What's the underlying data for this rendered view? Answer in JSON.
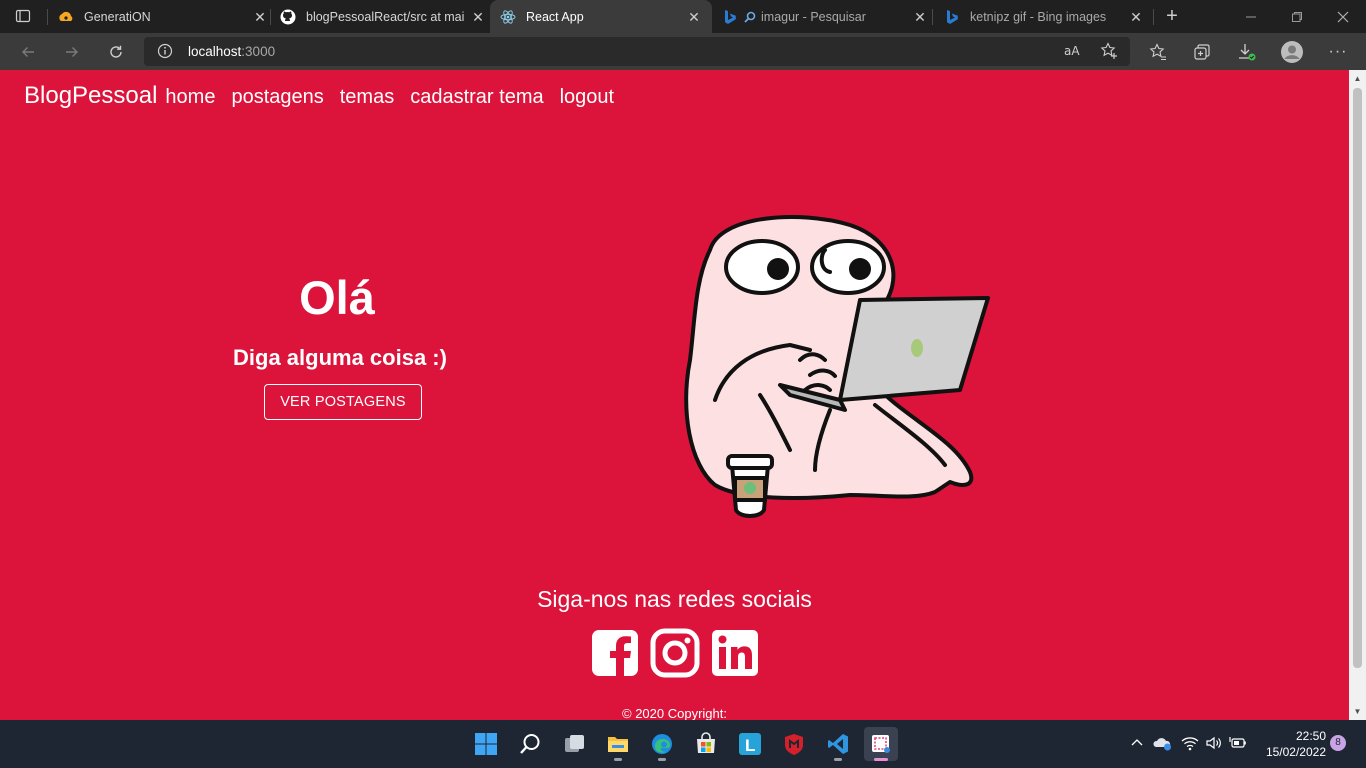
{
  "browser": {
    "tabs": [
      {
        "title": "GeneratiON",
        "icon": "generation-icon"
      },
      {
        "title": "blogPessoalReact/src at main",
        "icon": "github-icon"
      },
      {
        "title": "React App",
        "icon": "react-icon"
      },
      {
        "title": "imagur - Pesquisar",
        "icon": "bing-icon"
      },
      {
        "title": "ketnipz gif - Bing images",
        "icon": "bing-icon"
      }
    ],
    "url_host": "localhost",
    "url_port": ":3000"
  },
  "page": {
    "nav": {
      "brand": "BlogPessoal",
      "links": [
        "home",
        "postagens",
        "temas",
        "cadastrar tema",
        "logout"
      ]
    },
    "hero": {
      "title": "Olá",
      "subtitle": "Diga alguma coisa :)",
      "button": "VER POSTAGENS"
    },
    "footer": {
      "social_title": "Siga-nos nas redes sociais",
      "social": [
        "facebook-icon",
        "instagram-icon",
        "linkedin-icon"
      ],
      "copyright": "© 2020 Copyright:"
    },
    "colors": {
      "background": "#dc143c",
      "text": "#ffffff"
    }
  },
  "taskbar": {
    "time": "22:50",
    "date": "15/02/2022",
    "notifications": "8"
  }
}
